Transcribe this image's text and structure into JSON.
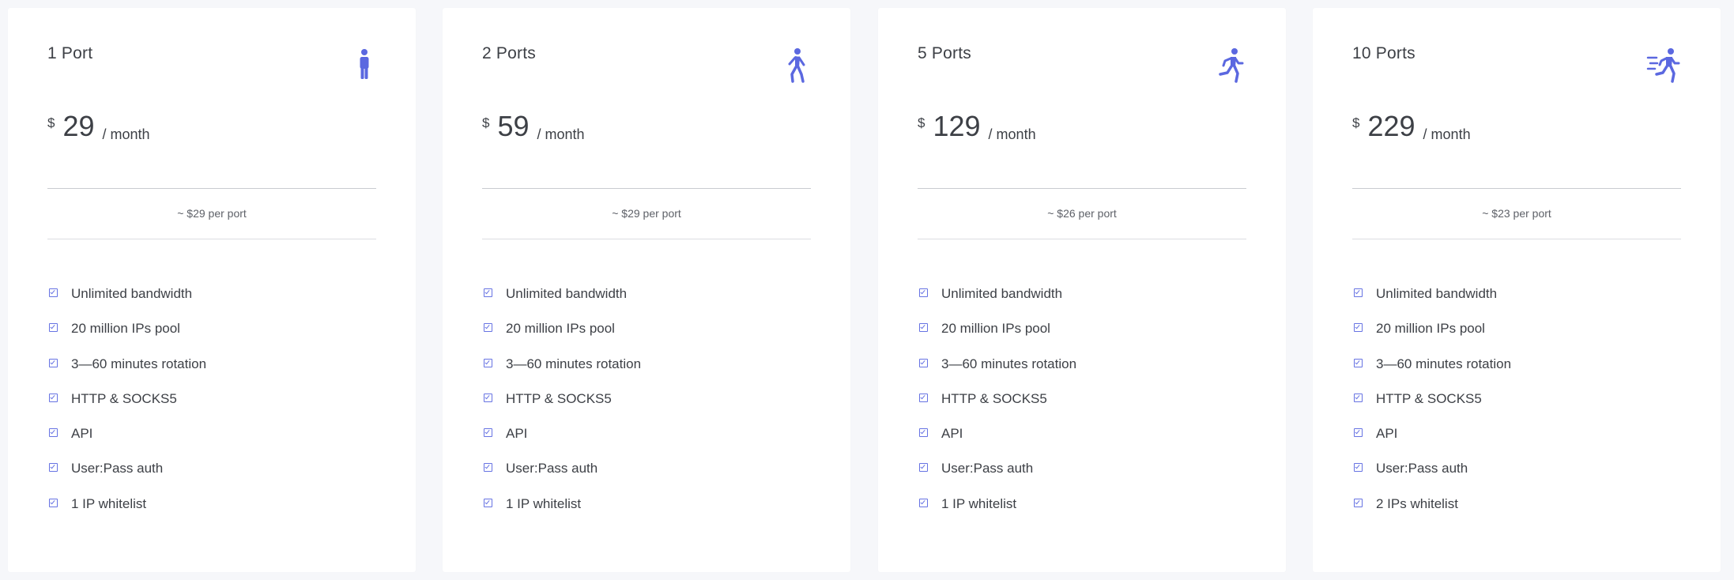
{
  "accent_color": "#5b68e0",
  "plans": [
    {
      "title": "1 Port",
      "icon": "standing-person-icon",
      "currency": "$",
      "amount": "29",
      "period": "/ month",
      "per_port": "~ $29 per port",
      "features": [
        "Unlimited bandwidth",
        "20 million IPs pool",
        "3—60 minutes rotation",
        "HTTP & SOCKS5",
        "API",
        "User:Pass auth",
        "1 IP whitelist"
      ]
    },
    {
      "title": "2 Ports",
      "icon": "walking-person-icon",
      "currency": "$",
      "amount": "59",
      "period": "/ month",
      "per_port": "~ $29 per port",
      "features": [
        "Unlimited bandwidth",
        "20 million IPs pool",
        "3—60 minutes rotation",
        "HTTP & SOCKS5",
        "API",
        "User:Pass auth",
        "1 IP whitelist"
      ]
    },
    {
      "title": "5 Ports",
      "icon": "running-person-icon",
      "currency": "$",
      "amount": "129",
      "period": "/ month",
      "per_port": "~ $26 per port",
      "features": [
        "Unlimited bandwidth",
        "20 million IPs pool",
        "3—60 minutes rotation",
        "HTTP & SOCKS5",
        "API",
        "User:Pass auth",
        "1 IP whitelist"
      ]
    },
    {
      "title": "10 Ports",
      "icon": "sprinting-person-icon",
      "currency": "$",
      "amount": "229",
      "period": "/ month",
      "per_port": "~ $23 per port",
      "features": [
        "Unlimited bandwidth",
        "20 million IPs pool",
        "3—60 minutes rotation",
        "HTTP & SOCKS5",
        "API",
        "User:Pass auth",
        "2 IPs whitelist"
      ]
    }
  ]
}
